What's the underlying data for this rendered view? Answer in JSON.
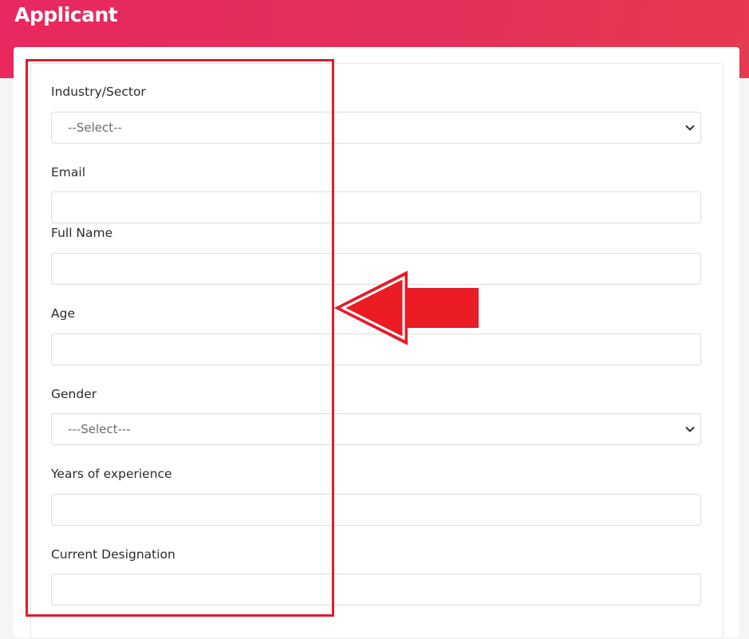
{
  "header": {
    "title": "Applicant"
  },
  "form": {
    "industry": {
      "label": "Industry/Sector",
      "selected": "--Select--"
    },
    "email": {
      "label": "Email",
      "value": ""
    },
    "full_name": {
      "label": "Full Name",
      "value": ""
    },
    "age": {
      "label": "Age",
      "value": ""
    },
    "gender": {
      "label": "Gender",
      "selected": "---Select---"
    },
    "experience": {
      "label": "Years of experience",
      "value": ""
    },
    "designation": {
      "label": "Current Designation",
      "value": ""
    }
  },
  "colors": {
    "header_accent": "#e2315a",
    "annotation_red": "#e01b2c"
  },
  "icons": {
    "select_chevron": "chevron-down-icon"
  }
}
